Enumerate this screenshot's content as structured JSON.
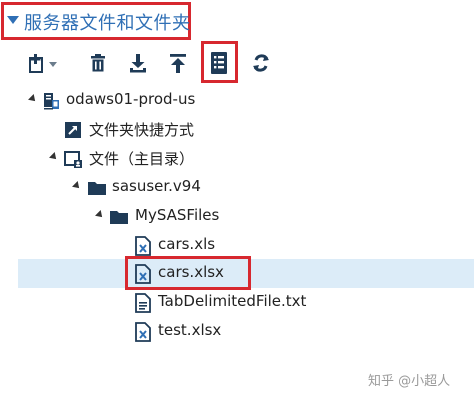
{
  "header": {
    "title": "服务器文件和文件夹"
  },
  "toolbar": {
    "buttons": [
      {
        "name": "new",
        "icon": "new-item-icon"
      },
      {
        "name": "delete",
        "icon": "trash-icon"
      },
      {
        "name": "download",
        "icon": "download-icon"
      },
      {
        "name": "upload",
        "icon": "upload-icon"
      },
      {
        "name": "properties",
        "icon": "properties-list-icon",
        "selected": true
      },
      {
        "name": "refresh",
        "icon": "refresh-icon"
      }
    ]
  },
  "tree": {
    "server": "odaws01-prod-us",
    "shortcuts": "文件夹快捷方式",
    "home": "文件（主目录）",
    "sasuser": "sasuser.v94",
    "mysasfiles": "MySASFiles",
    "files": [
      {
        "name": "cars.xls",
        "selected": false
      },
      {
        "name": "cars.xlsx",
        "selected": true
      },
      {
        "name": "TabDelimitedFile.txt",
        "selected": false
      },
      {
        "name": "test.xlsx",
        "selected": false
      }
    ]
  },
  "watermark": "知乎 @小超人",
  "colors": {
    "accent": "#2f6fb5",
    "highlight": "#d7282f",
    "selection": "#dcecf8",
    "icon": "#1f3b57"
  }
}
